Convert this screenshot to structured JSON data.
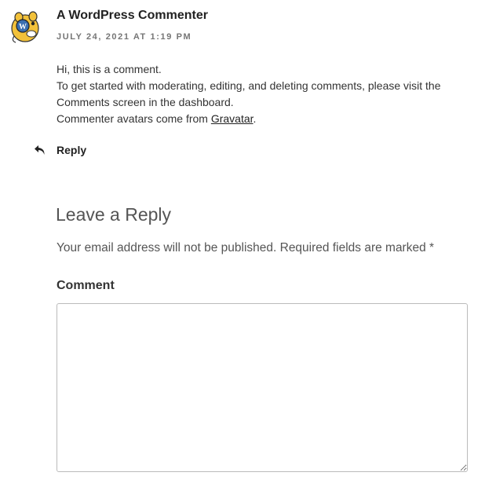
{
  "comment": {
    "avatar_icon": "wapuu-avatar-icon",
    "author": "A WordPress Commenter",
    "date": "JULY 24, 2021 AT 1:19 PM",
    "body": {
      "line1": "Hi, this is a comment.",
      "line2": "To get started with moderating, editing, and deleting comments, please visit the Comments screen in the dashboard.",
      "line3_prefix": "Commenter avatars come from ",
      "line3_link": "Gravatar",
      "line3_suffix": "."
    },
    "reply_icon": "reply-arrow-icon",
    "reply_label": "Reply"
  },
  "reply_form": {
    "title": "Leave a Reply",
    "notes": "Your email address will not be published. Required fields are marked *",
    "comment_label": "Comment",
    "comment_value": ""
  },
  "colors": {
    "text": "#333333",
    "heading": "#222222",
    "meta": "#767676",
    "border": "#bbbbbb"
  }
}
